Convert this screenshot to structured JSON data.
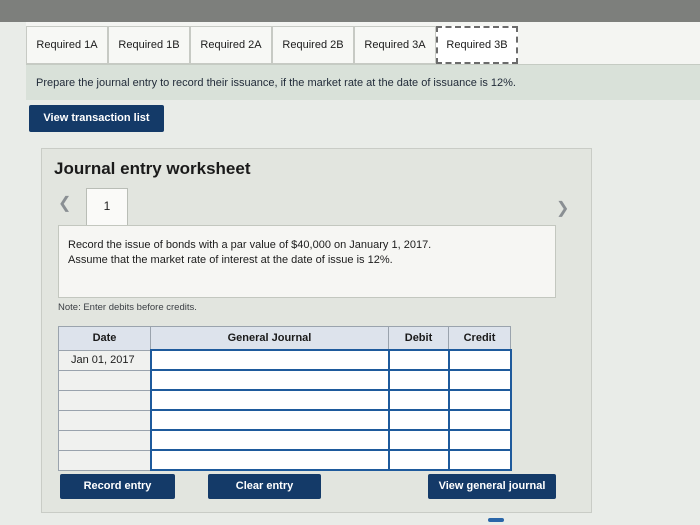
{
  "tabs": [
    {
      "label": "Required 1A",
      "active": false
    },
    {
      "label": "Required 1B",
      "active": false
    },
    {
      "label": "Required 2A",
      "active": false
    },
    {
      "label": "Required 2B",
      "active": false
    },
    {
      "label": "Required 3A",
      "active": false
    },
    {
      "label": "Required 3B",
      "active": true
    }
  ],
  "instruction": "Prepare the journal entry to record their issuance, if the market rate at the date of issuance is 12%.",
  "view_transaction_list": "View transaction list",
  "worksheet": {
    "title": "Journal entry worksheet",
    "page_number": "1",
    "prev_icon": "chevron-left-icon",
    "next_icon": "chevron-right-icon",
    "description_line1": "Record the issue of bonds with a par value of $40,000 on January 1, 2017.",
    "description_line2": "Assume that the market rate of interest at the date of issue is 12%.",
    "note": "Note: Enter debits before credits."
  },
  "journal": {
    "headers": {
      "date": "Date",
      "general_journal": "General Journal",
      "debit": "Debit",
      "credit": "Credit"
    },
    "rows": [
      {
        "date": "Jan 01, 2017",
        "account": "",
        "debit": "",
        "credit": ""
      },
      {
        "date": "",
        "account": "",
        "debit": "",
        "credit": ""
      },
      {
        "date": "",
        "account": "",
        "debit": "",
        "credit": ""
      },
      {
        "date": "",
        "account": "",
        "debit": "",
        "credit": ""
      },
      {
        "date": "",
        "account": "",
        "debit": "",
        "credit": ""
      },
      {
        "date": "",
        "account": "",
        "debit": "",
        "credit": ""
      }
    ]
  },
  "buttons": {
    "record_entry": "Record entry",
    "clear_entry": "Clear entry",
    "view_general_journal": "View general journal"
  },
  "colors": {
    "primary_button": "#143a68",
    "input_border": "#1e5a9c"
  }
}
